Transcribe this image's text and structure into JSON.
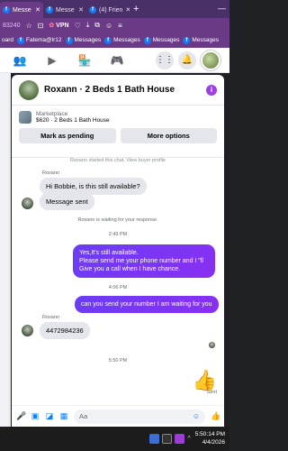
{
  "browser": {
    "tabs": [
      {
        "label": "Messe",
        "active": true
      },
      {
        "label": "Messe",
        "active": false
      },
      {
        "label": "(4) Frien",
        "active": false
      }
    ],
    "address_partial": "83240",
    "vpn_label": "VPN",
    "bookmarks": [
      "oard",
      "Fatema@lr12",
      "Messages",
      "Messages",
      "Messages",
      "Messages"
    ]
  },
  "chat": {
    "title": "Roxann · 2 Beds 1 Bath House",
    "more_icon": "i",
    "marketplace": {
      "label": "Marketplace",
      "listing": "$620 · 2 Beds 1 Bath House",
      "btn_pending": "Mark as pending",
      "btn_more": "More options"
    },
    "partial_top_text": "Roxann started this chat. View buyer profile",
    "messages": {
      "sender1": "Roxann",
      "in1": "Hi Bobbie, is this still available?",
      "in2": "Message sent",
      "waiting": "Roxann is waiting for your response.",
      "time1": "2:49 PM",
      "out1_line1": "Yes,It's still available.",
      "out1_line2": "Please send me your phone number and I \"ll Give you a call when I have chance.",
      "time2": "4:06 PM",
      "out2": "can you send your number I am waiting for you",
      "sender2": "Roxann",
      "in3": "4472984236",
      "time3": "5:50 PM",
      "sent_label": "Sent"
    },
    "composer_placeholder": "Aa"
  },
  "taskbar": {
    "time": "5:50:14 PM",
    "date": "4/4/2026"
  }
}
